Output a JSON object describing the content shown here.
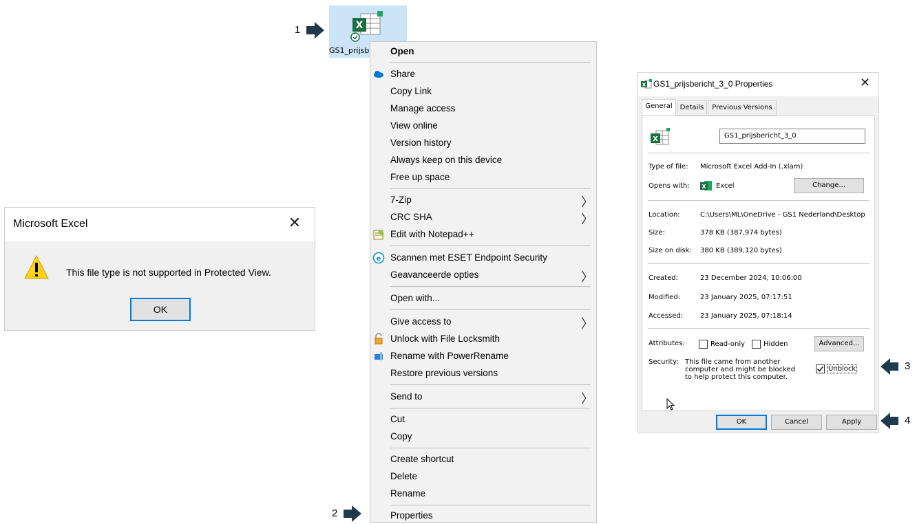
{
  "steps": {
    "one": "1",
    "two": "2",
    "three": "3",
    "four": "4"
  },
  "desktop_file": {
    "label": "GS1_prijsbe",
    "icon": "excel-file-icon"
  },
  "error_dialog": {
    "title": "Microsoft Excel",
    "message": "This file type is not supported in Protected View.",
    "ok": "OK"
  },
  "context_menu": {
    "open": "Open",
    "share": "Share",
    "copy_link": "Copy Link",
    "manage_access": "Manage access",
    "view_online": "View online",
    "version_history": "Version history",
    "always_keep": "Always keep on this device",
    "free_up": "Free up space",
    "zip": "7-Zip",
    "crc": "CRC SHA",
    "notepad": "Edit with Notepad++",
    "eset": "Scannen met ESET Endpoint Security",
    "advanced_options": "Geavanceerde opties",
    "open_with": "Open with...",
    "give_access": "Give access to",
    "unlock": "Unlock with File Locksmith",
    "power_rename": "Rename with PowerRename",
    "restore": "Restore previous versions",
    "send_to": "Send to",
    "cut": "Cut",
    "copy": "Copy",
    "create_shortcut": "Create shortcut",
    "delete": "Delete",
    "rename": "Rename",
    "properties": "Properties"
  },
  "properties": {
    "title": "GS1_prijsbericht_3_0 Properties",
    "tabs": [
      "General",
      "Details",
      "Previous Versions"
    ],
    "filename": "GS1_prijsbericht_3_0",
    "type_label": "Type of file:",
    "type_value": "Microsoft Excel Add-In (.xlam)",
    "opens_label": "Opens with:",
    "opens_value": "Excel",
    "change": "Change...",
    "location_label": "Location:",
    "location_value": "C:\\Users\\ML\\OneDrive - GS1 Nederland\\Desktop",
    "size_label": "Size:",
    "size_value": "378 KB (387,974 bytes)",
    "disk_label": "Size on disk:",
    "disk_value": "380 KB (389,120 bytes)",
    "created_label": "Created:",
    "created_value": "23 December 2024, 10:06:00",
    "modified_label": "Modified:",
    "modified_value": "23 January 2025, 07:17:51",
    "accessed_label": "Accessed:",
    "accessed_value": "23 January 2025, 07:18:14",
    "attributes_label": "Attributes:",
    "readonly": "Read-only",
    "hidden": "Hidden",
    "advanced": "Advanced...",
    "security_label": "Security:",
    "security_text_1": "This file came from another",
    "security_text_2": "computer and might be blocked",
    "security_text_3": "to help protect this computer.",
    "unblock": "Unblock",
    "unblock_checked": true,
    "ok": "OK",
    "cancel": "Cancel",
    "apply": "Apply"
  },
  "colors": {
    "accent": "#0078d7",
    "arrow": "#1f3a4d",
    "excel": "#1d6f42"
  }
}
